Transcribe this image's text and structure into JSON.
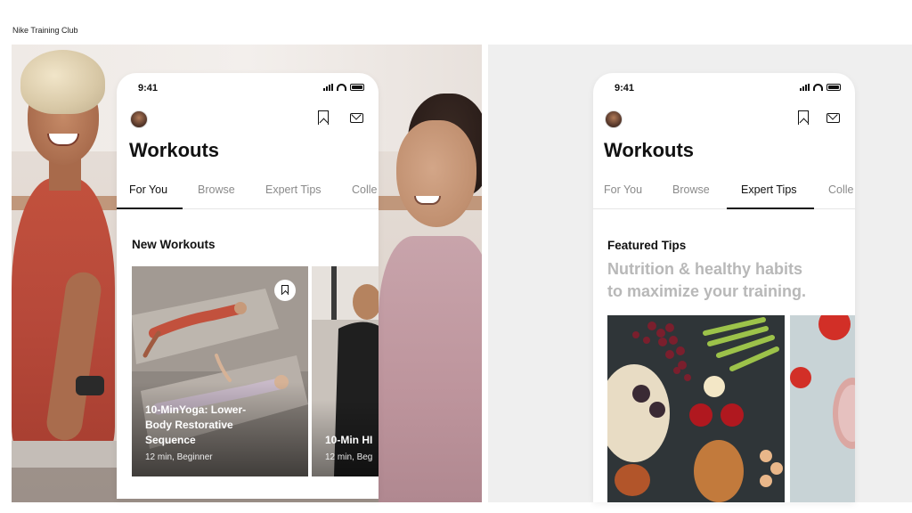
{
  "caption": "Nike Training Club",
  "colors": {
    "accent": "#111111",
    "muted_tab": "#8a8a8a",
    "subtitle_gray": "#b8b8b8"
  },
  "icons": [
    "signal-icon",
    "wifi-icon",
    "battery-icon",
    "bookmark-icon",
    "mail-icon"
  ],
  "screen_a": {
    "status_time": "9:41",
    "title": "Workouts",
    "tabs": [
      {
        "label": "For You",
        "active": true
      },
      {
        "label": "Browse",
        "active": false
      },
      {
        "label": "Expert Tips",
        "active": false
      },
      {
        "label": "Colle",
        "active": false
      }
    ],
    "section_title": "New Workouts",
    "cards": [
      {
        "title_line1": "10-MinYoga: Lower-",
        "title_line2": "Body Restorative",
        "title_line3": "Sequence",
        "meta": "12 min, Beginner"
      },
      {
        "title_line1": "10-Min HI",
        "meta": "12 min, Beg"
      }
    ]
  },
  "screen_b": {
    "status_time": "9:41",
    "title": "Workouts",
    "tabs": [
      {
        "label": "For You",
        "active": false
      },
      {
        "label": "Browse",
        "active": false
      },
      {
        "label": "Expert Tips",
        "active": true
      },
      {
        "label": "Colle",
        "active": false
      }
    ],
    "section_title": "Featured Tips",
    "subtitle_line1": "Nutrition & healthy habits",
    "subtitle_line2": "to maximize your training."
  }
}
